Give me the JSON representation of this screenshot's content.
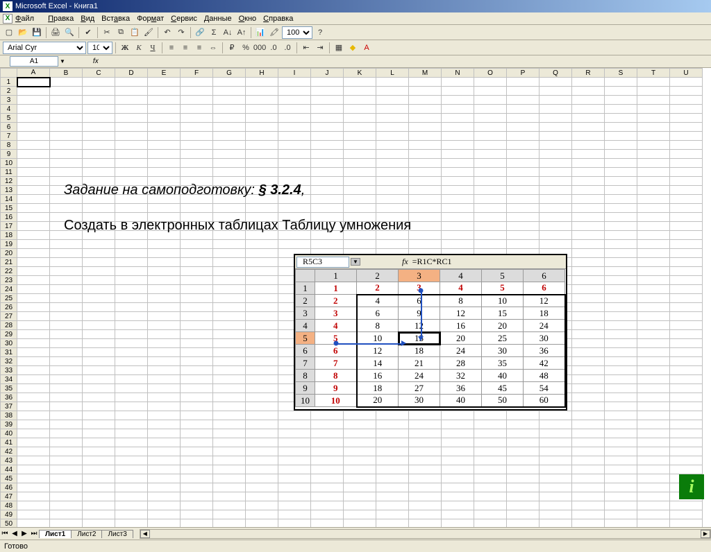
{
  "window": {
    "title": "Microsoft Excel - Книга1"
  },
  "menu": {
    "file": "Файл",
    "edit": "Правка",
    "view": "Вид",
    "insert": "Вставка",
    "format": "Формат",
    "tools": "Сервис",
    "data": "Данные",
    "window": "Окно",
    "help": "Справка"
  },
  "toolbar": {
    "zoom": "100%"
  },
  "formatbar": {
    "font": "Arial Cyr",
    "size": "10"
  },
  "formulabar": {
    "name": "A1",
    "fx": "fx",
    "formula": ""
  },
  "columns": [
    "A",
    "B",
    "C",
    "D",
    "E",
    "F",
    "G",
    "H",
    "I",
    "J",
    "K",
    "L",
    "M",
    "N",
    "O",
    "P",
    "Q",
    "R",
    "S",
    "T",
    "U"
  ],
  "row_count": 51,
  "overlay": {
    "line1_prefix": "Задание на самоподготовку: ",
    "line1_bold": "§ 3.2.4",
    "line1_suffix": ",",
    "line2": "Создать в электронных таблицах Таблицу умножения"
  },
  "mini": {
    "namebox": "R5C3",
    "fx": "fx",
    "formula": "=R1C*RC1",
    "col_headers": [
      "1",
      "2",
      "3",
      "4",
      "5",
      "6"
    ],
    "rows": [
      {
        "h": "1",
        "cells": [
          "1",
          "2",
          "3",
          "4",
          "5",
          "6"
        ]
      },
      {
        "h": "2",
        "cells": [
          "2",
          "4",
          "6",
          "8",
          "10",
          "12"
        ]
      },
      {
        "h": "3",
        "cells": [
          "3",
          "6",
          "9",
          "12",
          "15",
          "18"
        ]
      },
      {
        "h": "4",
        "cells": [
          "4",
          "8",
          "12",
          "16",
          "20",
          "24"
        ]
      },
      {
        "h": "5",
        "cells": [
          "5",
          "10",
          "15",
          "20",
          "25",
          "30"
        ]
      },
      {
        "h": "6",
        "cells": [
          "6",
          "12",
          "18",
          "24",
          "30",
          "36"
        ]
      },
      {
        "h": "7",
        "cells": [
          "7",
          "14",
          "21",
          "28",
          "35",
          "42"
        ]
      },
      {
        "h": "8",
        "cells": [
          "8",
          "16",
          "24",
          "32",
          "40",
          "48"
        ]
      },
      {
        "h": "9",
        "cells": [
          "9",
          "18",
          "27",
          "36",
          "45",
          "54"
        ]
      },
      {
        "h": "10",
        "cells": [
          "10",
          "20",
          "30",
          "40",
          "50",
          "60"
        ]
      }
    ]
  },
  "tabs": {
    "s1": "Лист1",
    "s2": "Лист2",
    "s3": "Лист3"
  },
  "status": {
    "ready": "Готово"
  },
  "info_badge": "i"
}
